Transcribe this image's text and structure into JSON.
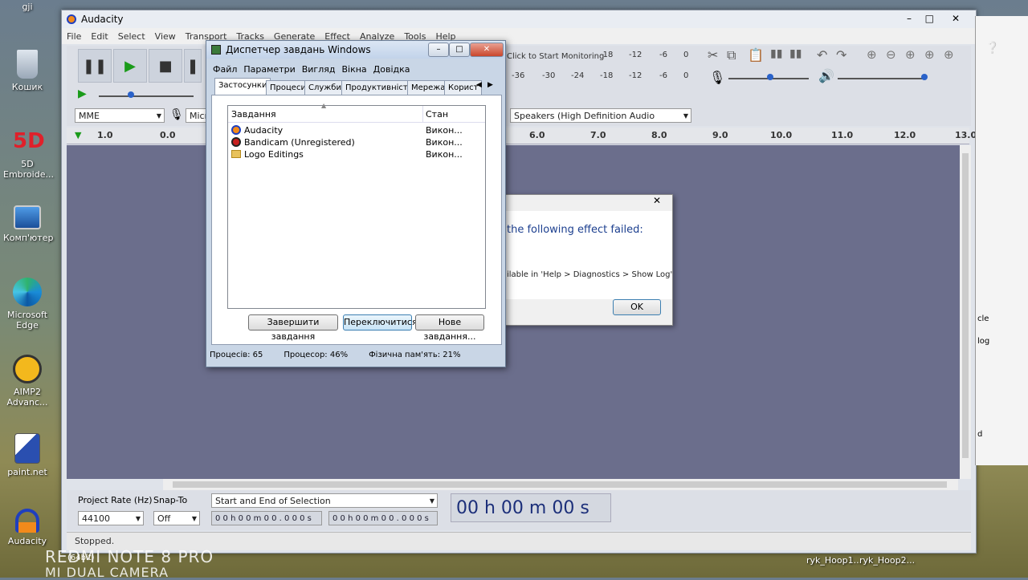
{
  "desktop": {
    "icons": [
      {
        "label": "gji"
      },
      {
        "label": "Кошик"
      },
      {
        "label": "5D Embroide..."
      },
      {
        "label": "Комп'ютер"
      },
      {
        "label": "Microsoft Edge"
      },
      {
        "label": "AIMP2 Advanc..."
      },
      {
        "label": "paint.net"
      },
      {
        "label": "Audacity"
      }
    ],
    "watermark_line1": "REDMI NOTE 8 PRO",
    "watermark_line2": "MI DUAL CAMERA",
    "taskbar_items": [
      "ryk_Hoop1...",
      "ryk_Hoop2..."
    ],
    "bits_label": "(64bit)"
  },
  "audacity": {
    "title": "Audacity",
    "menu": [
      "File",
      "Edit",
      "Select",
      "View",
      "Transport",
      "Tracks",
      "Generate",
      "Effect",
      "Analyze",
      "Tools",
      "Help"
    ],
    "host": "MME",
    "mic_device": "Micr",
    "output_device": "Speakers (High Definition Audio",
    "monitor_label": "Click to Start Monitoring",
    "meter_top": [
      "-18",
      "-12",
      "-6",
      "0"
    ],
    "meter_bottom": [
      "-36",
      "-30",
      "-24",
      "-18",
      "-12",
      "-6",
      "0"
    ],
    "ruler": [
      "1.0",
      "0.0",
      "6.0",
      "7.0",
      "8.0",
      "9.0",
      "10.0",
      "11.0",
      "12.0",
      "13.0"
    ],
    "project_rate_label": "Project Rate (Hz)",
    "project_rate": "44100",
    "snap_label": "Snap-To",
    "snap_value": "Off",
    "selection_mode": "Start and End of Selection",
    "sel_start": "0 0 h 0 0 m 0 0 . 0 0 0 s",
    "sel_end": "0 0 h 0 0 m 0 0 . 0 0 0 s",
    "time_display": "00 h 00 m 00 s",
    "status": "Stopped.",
    "right_cut_text": [
      "cle",
      "log",
      "d"
    ]
  },
  "error_dialog": {
    "message1": "the following effect failed:",
    "message2": "ilable in 'Help > Diagnostics > Show Log'",
    "ok_label": "OK"
  },
  "taskmanager": {
    "title": "Диспетчер завдань Windows",
    "menu": [
      "Файл",
      "Параметри",
      "Вигляд",
      "Вікна",
      "Довідка"
    ],
    "tabs": [
      "Застосунки",
      "Процеси",
      "Служби",
      "Продуктивність",
      "Мережа",
      "Корист"
    ],
    "columns": [
      "Завдання",
      "Стан"
    ],
    "rows": [
      {
        "name": "Audacity",
        "state": "Викон..."
      },
      {
        "name": "Bandicam (Unregistered)",
        "state": "Викон..."
      },
      {
        "name": "Logo Editings",
        "state": "Викон..."
      }
    ],
    "buttons": [
      "Завершити завдання",
      "Переключитися",
      "Нове завдання..."
    ],
    "status": [
      "Процесів: 65",
      "Процесор: 46%",
      "Фізична пам'ять: 21%"
    ]
  }
}
